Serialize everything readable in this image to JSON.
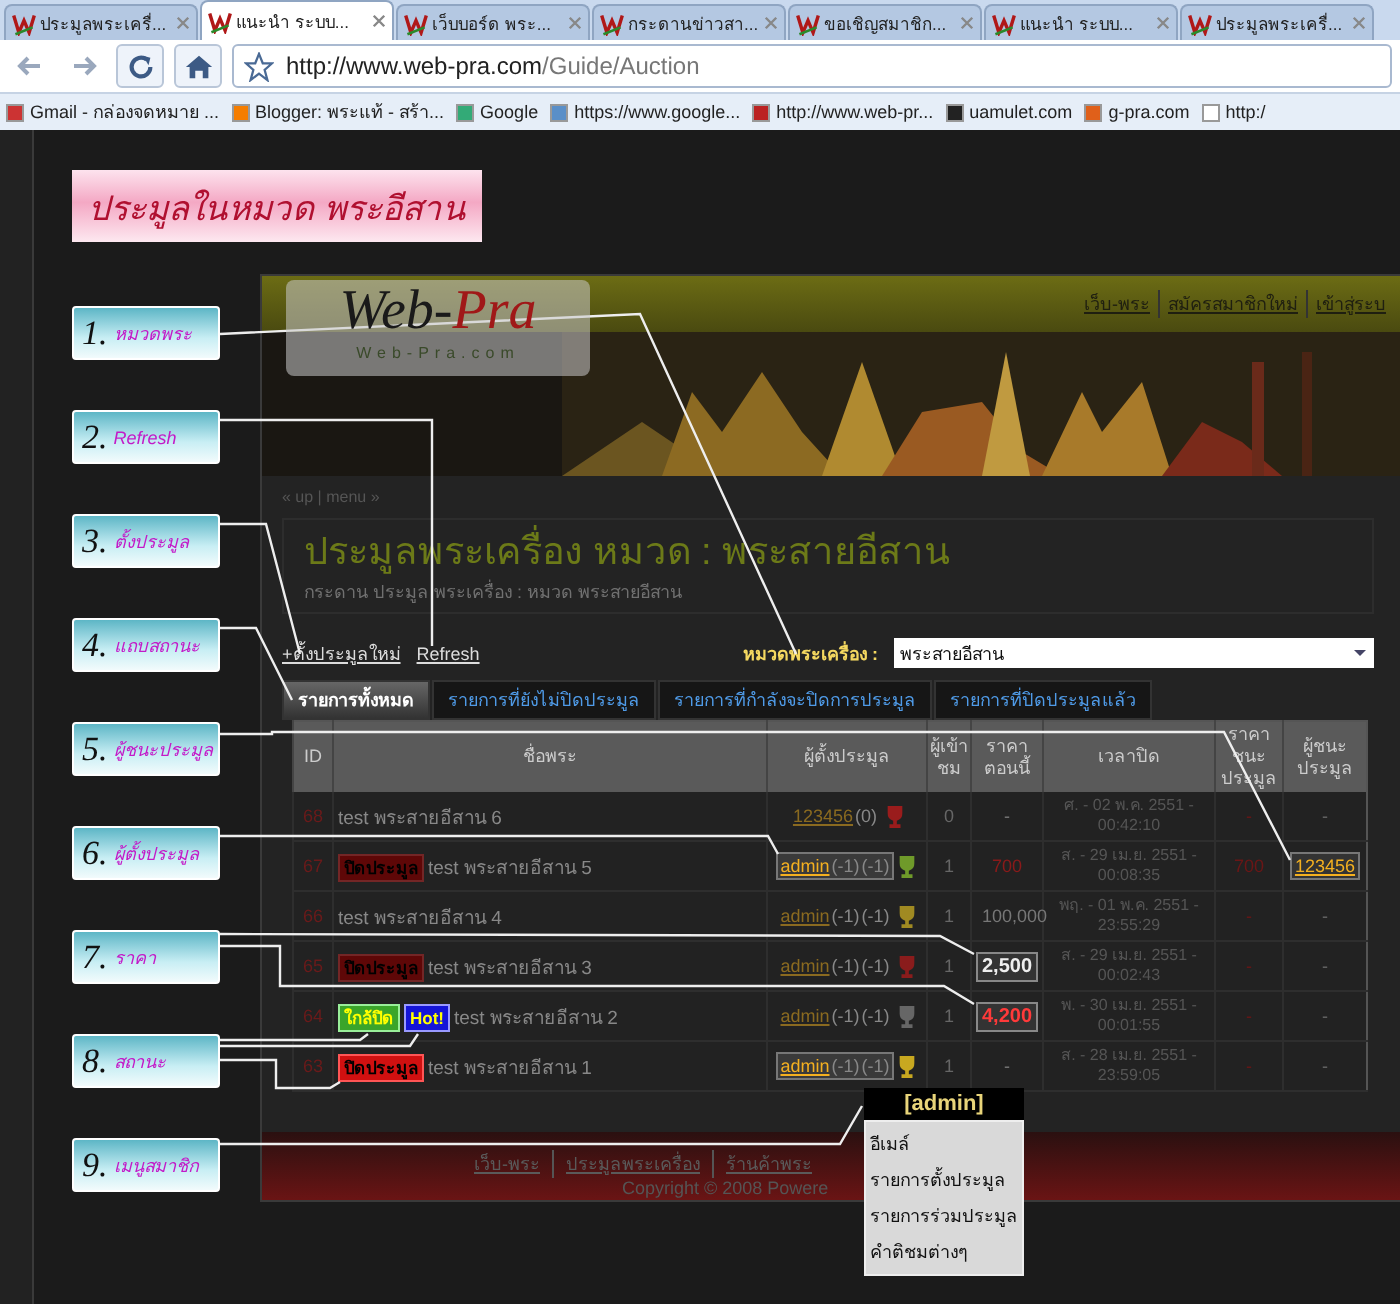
{
  "browser": {
    "tabs": [
      {
        "title": "ประมูลพระเครื่...",
        "selected": false
      },
      {
        "title": "แนะนำ ระบบ...",
        "selected": true
      },
      {
        "title": "เว็บบอร์ด พระ...",
        "selected": false
      },
      {
        "title": "กระดานข่าวสา...",
        "selected": false
      },
      {
        "title": "ขอเชิญสมาชิก...",
        "selected": false
      },
      {
        "title": "แนะนำ ระบบ...",
        "selected": false
      },
      {
        "title": "ประมูลพระเครื่...",
        "selected": false
      }
    ],
    "address_host": "http://www.web-pra.com",
    "address_path": "/Guide/Auction",
    "bookmarks": [
      {
        "label": "Gmail - กล่องจดหมาย ...",
        "kind": "mail"
      },
      {
        "label": "Blogger: พระแท้ - สร้า...",
        "kind": "blogger"
      },
      {
        "label": "Google",
        "kind": "google"
      },
      {
        "label": "https://www.google...",
        "kind": "chart"
      },
      {
        "label": "http://www.web-pr...",
        "kind": "site"
      },
      {
        "label": "uamulet.com",
        "kind": "uamulet"
      },
      {
        "label": "g-pra.com",
        "kind": "gpra"
      },
      {
        "label": "http:/",
        "kind": "page"
      }
    ]
  },
  "title_banner": "ประมูลในหมวด พระอีสาน",
  "callouts": [
    {
      "number": "1.",
      "label": "หมวดพระ"
    },
    {
      "number": "2.",
      "label": "Refresh"
    },
    {
      "number": "3.",
      "label": "ตั้งประมูล"
    },
    {
      "number": "4.",
      "label": "แถบสถานะ"
    },
    {
      "number": "5.",
      "label": "ผู้ชนะประมูล"
    },
    {
      "number": "6.",
      "label": "ผู้ตั้งประมูล"
    },
    {
      "number": "7.",
      "label": "ราคา"
    },
    {
      "number": "8.",
      "label": "สถานะ"
    },
    {
      "number": "9.",
      "label": "เมนูสมาชิก"
    }
  ],
  "site": {
    "top_links": [
      "เว็บ-พระ",
      "สมัครสมาชิกใหม่",
      "เข้าสู่ระบ"
    ],
    "logo_main": "Web-",
    "logo_accent": "Pra",
    "logo_sub": "Web-Pra.com",
    "breadcrumb": "« up | menu »",
    "heading": "ประมูลพระเครื่อง หมวด : พระสายอีสาน",
    "subheading": "กระดาน ประมูล พระเครื่อง : หมวด พระสายอีสาน",
    "actions": [
      "+ตั้งประมูลใหม่",
      "Refresh"
    ],
    "category_label": "หมวดพระเครื่อง :",
    "category_value": "พระสายอีสาน",
    "tabs": [
      {
        "label": "รายการทั้งหมด",
        "selected": true
      },
      {
        "label": "รายการที่ยังไม่ปิดประมูล",
        "selected": false
      },
      {
        "label": "รายการที่กำลังจะปิดการประมูล",
        "selected": false
      },
      {
        "label": "รายการที่ปิดประมูลแล้ว",
        "selected": false
      }
    ],
    "table": {
      "columns": [
        "ID",
        "ชื่อพระ",
        "ผู้ตั้งประมูล",
        "ผู้เข้าชม",
        "ราคาตอนนี้",
        "เวลาปิด",
        "ราคาชนะประมูล",
        "ผู้ชนะประมูล"
      ],
      "rows": [
        {
          "id": "68",
          "badges": [],
          "name": "test พระสายอีสาน 6",
          "seller": "123456",
          "seller_counts": [
            "(0)"
          ],
          "seller_highlighted": false,
          "trophy": {
            "color": "#9a1c1c"
          },
          "views": "0",
          "price": "-",
          "bid_placed": false,
          "price_highlighted": false,
          "close_time": "ศ. - 02 พ.ค. 2551 - 00:42:10",
          "win_price": "-",
          "winner": "-",
          "winner_highlighted": false
        },
        {
          "id": "67",
          "badges": [
            {
              "text": "ปิดประมูล",
              "kind": "closed",
              "highlighted": false
            }
          ],
          "name": "test พระสายอีสาน 5",
          "seller": "admin",
          "seller_counts": [
            "(-1)",
            "(-1)"
          ],
          "seller_highlighted": true,
          "trophy": {
            "color": "#6f9a2a"
          },
          "views": "1",
          "price": "700",
          "bid_placed": true,
          "price_highlighted": false,
          "close_time": "ส. - 29 เม.ย. 2551 - 00:08:35",
          "win_price": "700",
          "winner": "123456",
          "winner_highlighted": true
        },
        {
          "id": "66",
          "badges": [],
          "name": "test พระสายอีสาน 4",
          "seller": "admin",
          "seller_counts": [
            "(-1)",
            "(-1)"
          ],
          "seller_highlighted": false,
          "trophy": {
            "color": "#a08a22"
          },
          "views": "1",
          "price": "100,000",
          "bid_placed": false,
          "price_highlighted": false,
          "close_time": "พฤ. - 01 พ.ค. 2551 - 23:55:29",
          "win_price": "-",
          "winner": "-",
          "winner_highlighted": false
        },
        {
          "id": "65",
          "badges": [
            {
              "text": "ปิดประมูล",
              "kind": "closed",
              "highlighted": false
            }
          ],
          "name": "test พระสายอีสาน 3",
          "seller": "admin",
          "seller_counts": [
            "(-1)",
            "(-1)"
          ],
          "seller_highlighted": false,
          "trophy": {
            "color": "#8a1c1c"
          },
          "views": "1",
          "price": "2,500",
          "bid_placed": false,
          "price_highlighted": true,
          "close_time": "ส. - 29 เม.ย. 2551 - 00:02:43",
          "win_price": "-",
          "winner": "-",
          "winner_highlighted": false
        },
        {
          "id": "64",
          "badges": [
            {
              "text": "ใกล้ปิด",
              "kind": "closing",
              "highlighted": true
            },
            {
              "text": "Hot!",
              "kind": "hot",
              "highlighted": true
            }
          ],
          "name": "test พระสายอีสาน 2",
          "seller": "admin",
          "seller_counts": [
            "(-1)",
            "(-1)"
          ],
          "seller_highlighted": false,
          "trophy": {
            "color": "#666666"
          },
          "views": "1",
          "price": "4,200",
          "bid_placed": true,
          "price_highlighted": true,
          "close_time": "พ. - 30 เม.ย. 2551 - 00:01:55",
          "win_price": "-",
          "winner": "-",
          "winner_highlighted": false
        },
        {
          "id": "63",
          "badges": [
            {
              "text": "ปิดประมูล",
              "kind": "closed",
              "highlighted": true
            }
          ],
          "name": "test พระสายอีสาน 1",
          "seller": "admin",
          "seller_counts": [
            "(-1)",
            "(-1)"
          ],
          "seller_highlighted": true,
          "trophy": {
            "color": "#c8a820"
          },
          "views": "1",
          "price": "-",
          "bid_placed": false,
          "price_highlighted": false,
          "close_time": "ส. - 28 เม.ย. 2551 - 23:59:05",
          "win_price": "-",
          "winner": "-",
          "winner_highlighted": false
        }
      ]
    },
    "footer_links": [
      "เว็บ-พระ",
      "ประมูลพระเครื่อง",
      "ร้านค้าพระ"
    ],
    "copyright": "Copyright © 2008 Powere"
  },
  "member_menu": {
    "title": "[admin]",
    "items": [
      "อีเมล์",
      "รายการตั้งประมูล",
      "รายการร่วมประมูล",
      "คำติชมต่างๆ"
    ]
  }
}
